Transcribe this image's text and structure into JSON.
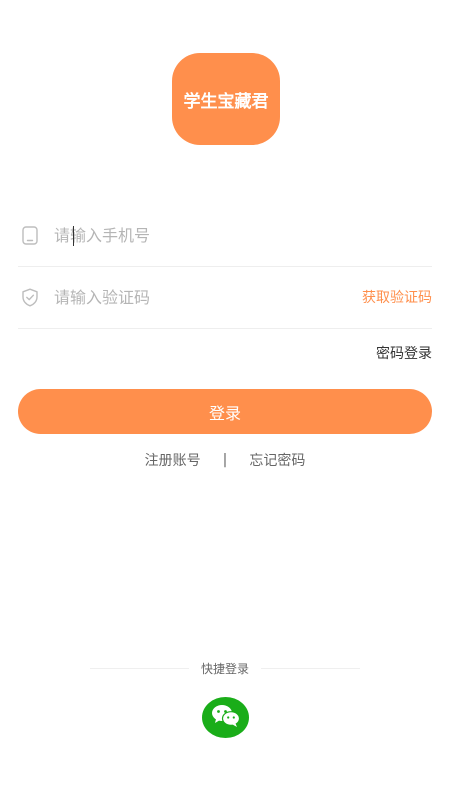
{
  "app": {
    "logo_text": "学生宝藏君",
    "brand_color": "#FF8F4C",
    "wechat_color": "#1AAD19"
  },
  "form": {
    "phone": {
      "value": "",
      "placeholder": "请输入手机号",
      "icon": "phone-icon"
    },
    "code": {
      "value": "",
      "placeholder": "请输入验证码",
      "icon": "shield-icon",
      "action_label": "获取验证码"
    },
    "password_login_label": "密码登录",
    "login_button_label": "登录"
  },
  "links": {
    "register_label": "注册账号",
    "separator": "|",
    "forgot_label": "忘记密码"
  },
  "quick_login": {
    "label": "快捷登录",
    "wechat_icon": "wechat-icon"
  }
}
